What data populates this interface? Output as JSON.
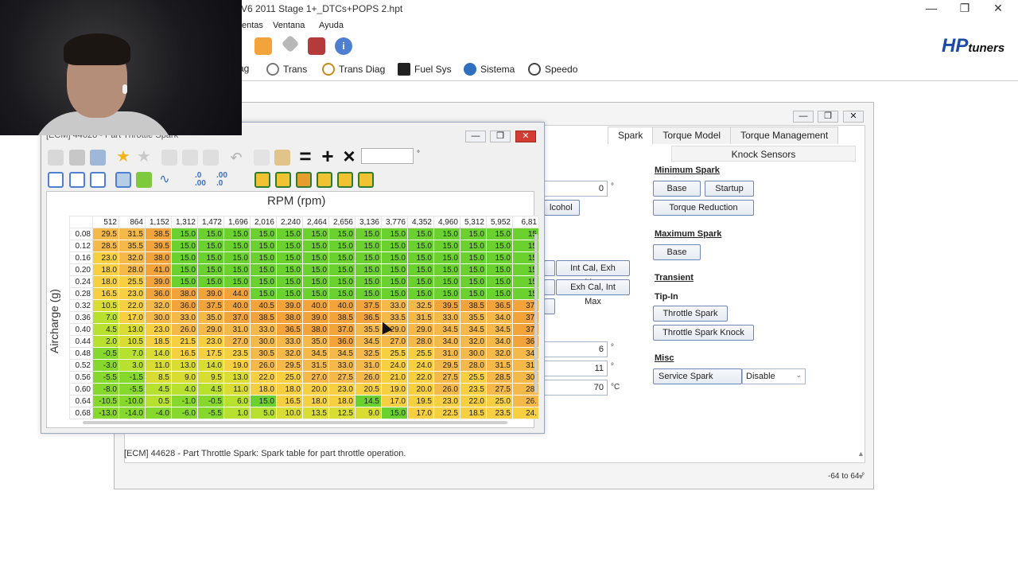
{
  "window": {
    "title": "V6 2011 Stage 1+_DTCs+POPS 2.hpt",
    "controls": {
      "minimize": "—",
      "maximize": "❐",
      "close": "✕"
    }
  },
  "menu": [
    "entas",
    "Ventana",
    "Ayuda"
  ],
  "toolbar2": [
    {
      "label": "ag",
      "icon": "diag-icon"
    },
    {
      "label": "Trans",
      "icon": "gear-icon"
    },
    {
      "label": "Trans Diag",
      "icon": "gear-icon"
    },
    {
      "label": "Fuel Sys",
      "icon": "fuel-pump-icon"
    },
    {
      "label": "Sistema",
      "icon": "globe-icon"
    },
    {
      "label": "Speedo",
      "icon": "speedometer-icon"
    }
  ],
  "brand": {
    "hp": "HP",
    "tuners": "tuners"
  },
  "editor": {
    "tabs": [
      "Spark",
      "Torque Model",
      "Torque Management"
    ],
    "active_tab": "Spark",
    "subtab": "Knock Sensors",
    "sections": {
      "min_spark": "Minimum Spark",
      "max_spark": "Maximum Spark",
      "transient": "Transient",
      "tipin": "Tip-In",
      "misc": "Misc"
    },
    "buttons": {
      "base": "Base",
      "startup": "Startup",
      "torque_reduction": "Torque Reduction",
      "max_base": "Base",
      "throttle_spark": "Throttle Spark",
      "throttle_spark_knock": "Throttle Spark Knock",
      "service_spark": "Service Spark",
      "alcohol": "lcohol",
      "int_cal_exh_max": "Int Cal, Exh Max",
      "exh_cal_int_max": "Exh Cal, Int Max"
    },
    "fields": {
      "field1": "0",
      "field2": "6",
      "field3": "11",
      "field4": "70"
    },
    "units": {
      "deg": "°",
      "celsius": "°C"
    },
    "service_spark_value": "Disable",
    "status": "[ECM] 44628 - Part Throttle Spark: Spark table for part throttle operation.",
    "range": "-64 to 64 °"
  },
  "table_window": {
    "title": "[ECM] 44628 - Part Throttle Spark",
    "x_axis_label": "RPM (rpm)",
    "y_axis_label": "Aircharge (g)",
    "input_value": "",
    "input_suffix": "°",
    "columns": [
      "512",
      "864",
      "1,152",
      "1,312",
      "1,472",
      "1,696",
      "2,016",
      "2,240",
      "2,464",
      "2,656",
      "3,136",
      "3,776",
      "4,352",
      "4,960",
      "5,312",
      "5,952",
      "6,81"
    ],
    "rows": [
      {
        "label": "0.08",
        "values": [
          "29.5",
          "31.5",
          "38.5",
          "15.0",
          "15.0",
          "15.0",
          "15.0",
          "15.0",
          "15.0",
          "15.0",
          "15.0",
          "15.0",
          "15.0",
          "15.0",
          "15.0",
          "15.0",
          "15"
        ]
      },
      {
        "label": "0.12",
        "values": [
          "28.5",
          "35.5",
          "39.5",
          "15.0",
          "15.0",
          "15.0",
          "15.0",
          "15.0",
          "15.0",
          "15.0",
          "15.0",
          "15.0",
          "15.0",
          "15.0",
          "15.0",
          "15.0",
          "15"
        ]
      },
      {
        "label": "0.16",
        "values": [
          "23.0",
          "32.0",
          "38.0",
          "15.0",
          "15.0",
          "15.0",
          "15.0",
          "15.0",
          "15.0",
          "15.0",
          "15.0",
          "15.0",
          "15.0",
          "15.0",
          "15.0",
          "15.0",
          "15"
        ]
      },
      {
        "label": "0.20",
        "values": [
          "18.0",
          "28.0",
          "41.0",
          "15.0",
          "15.0",
          "15.0",
          "15.0",
          "15.0",
          "15.0",
          "15.0",
          "15.0",
          "15.0",
          "15.0",
          "15.0",
          "15.0",
          "15.0",
          "15"
        ]
      },
      {
        "label": "0.24",
        "values": [
          "18.0",
          "25.5",
          "39.0",
          "15.0",
          "15.0",
          "15.0",
          "15.0",
          "15.0",
          "15.0",
          "15.0",
          "15.0",
          "15.0",
          "15.0",
          "15.0",
          "15.0",
          "15.0",
          "15"
        ]
      },
      {
        "label": "0.28",
        "values": [
          "16.5",
          "23.0",
          "36.0",
          "38.0",
          "39.0",
          "44.0",
          "15.0",
          "15.0",
          "15.0",
          "15.0",
          "15.0",
          "15.0",
          "15.0",
          "15.0",
          "15.0",
          "15.0",
          "15"
        ]
      },
      {
        "label": "0.32",
        "values": [
          "10.5",
          "22.0",
          "32.0",
          "36.0",
          "37.5",
          "40.0",
          "40.5",
          "39.0",
          "40.0",
          "40.0",
          "37.5",
          "33.0",
          "32.5",
          "39.5",
          "38.5",
          "36.5",
          "37."
        ]
      },
      {
        "label": "0.36",
        "values": [
          "7.0",
          "17.0",
          "30.0",
          "33.0",
          "35.0",
          "37.0",
          "38.5",
          "38.0",
          "39.0",
          "38.5",
          "36.5",
          "33.5",
          "31.5",
          "33.0",
          "35.5",
          "34.0",
          "37."
        ]
      },
      {
        "label": "0.40",
        "values": [
          "4.5",
          "13.0",
          "23.0",
          "26.0",
          "29.0",
          "31.0",
          "33.0",
          "36.5",
          "38.0",
          "37.0",
          "35.5",
          "29.0",
          "29.0",
          "34.5",
          "34.5",
          "34.5",
          "37."
        ]
      },
      {
        "label": "0.44",
        "values": [
          "2.0",
          "10.5",
          "18.5",
          "21.5",
          "23.0",
          "27.0",
          "30.0",
          "33.0",
          "35.0",
          "36.0",
          "34.5",
          "27.0",
          "28.0",
          "34.0",
          "32.0",
          "34.0",
          "36."
        ]
      },
      {
        "label": "0.48",
        "values": [
          "-0.5",
          "7.0",
          "14.0",
          "16.5",
          "17.5",
          "23.5",
          "30.5",
          "32.0",
          "34.5",
          "34.5",
          "32.5",
          "25.5",
          "25.5",
          "31.0",
          "30.0",
          "32.0",
          "34."
        ]
      },
      {
        "label": "0.52",
        "values": [
          "-3.0",
          "3.0",
          "11.0",
          "13.0",
          "14.0",
          "19.0",
          "26.0",
          "29.5",
          "31.5",
          "33.0",
          "31.0",
          "24.0",
          "24.0",
          "29.5",
          "28.0",
          "31.5",
          "31."
        ]
      },
      {
        "label": "0.56",
        "values": [
          "-5.5",
          "-1.5",
          "8.5",
          "9.0",
          "9.5",
          "13.0",
          "22.0",
          "25.0",
          "27.0",
          "27.5",
          "26.0",
          "21.0",
          "22.0",
          "27.5",
          "25.5",
          "28.5",
          "30."
        ]
      },
      {
        "label": "0.60",
        "values": [
          "-8.0",
          "-5.5",
          "4.5",
          "4.0",
          "4.5",
          "11.0",
          "18.0",
          "18.0",
          "20.0",
          "23.0",
          "20.5",
          "19.0",
          "20.0",
          "26.0",
          "23.5",
          "27.5",
          "28."
        ]
      },
      {
        "label": "0.64",
        "values": [
          "-10.5",
          "-10.0",
          "0.5",
          "-1.0",
          "-0.5",
          "6.0",
          "15.0",
          "16.5",
          "18.0",
          "18.0",
          "14.5",
          "17.0",
          "19.5",
          "23.0",
          "22.0",
          "25.0",
          "26."
        ]
      },
      {
        "label": "0.68",
        "values": [
          "-13.0",
          "-14.0",
          "-4.0",
          "-6.0",
          "-5.5",
          "1.0",
          "5.0",
          "10.0",
          "13.5",
          "12.5",
          "9.0",
          "15.0",
          "17.0",
          "22.5",
          "18.5",
          "23.5",
          "24."
        ]
      }
    ]
  }
}
